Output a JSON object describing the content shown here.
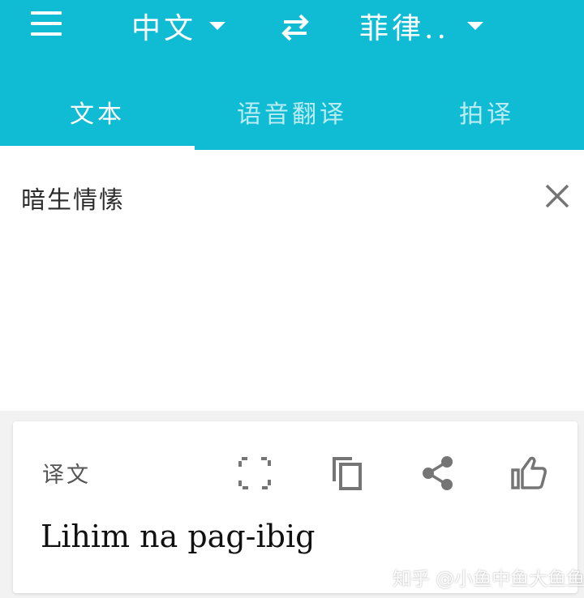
{
  "colors": {
    "accent": "#10bcd3",
    "on_accent": "#ffffff",
    "icon_gray": "#757575"
  },
  "toolbar": {
    "menu_icon": "hamburger-menu-icon",
    "source_language": "中文",
    "swap_icon": "swap-arrows-icon",
    "target_language": "菲律..",
    "dropdown_icon": "caret-down-icon"
  },
  "tabs": [
    {
      "label": "文本",
      "active": true
    },
    {
      "label": "语音翻译",
      "active": false
    },
    {
      "label": "拍译",
      "active": false
    }
  ],
  "input": {
    "value": "暗生情愫",
    "clear_icon": "close-icon"
  },
  "result": {
    "label": "译文",
    "translation": "Lihim na pag-ibig",
    "actions": [
      "fullscreen-icon",
      "copy-icon",
      "share-icon",
      "thumbs-up-icon"
    ]
  },
  "watermark": {
    "text": "知乎 @小鱼中鱼大鱼鱼"
  }
}
